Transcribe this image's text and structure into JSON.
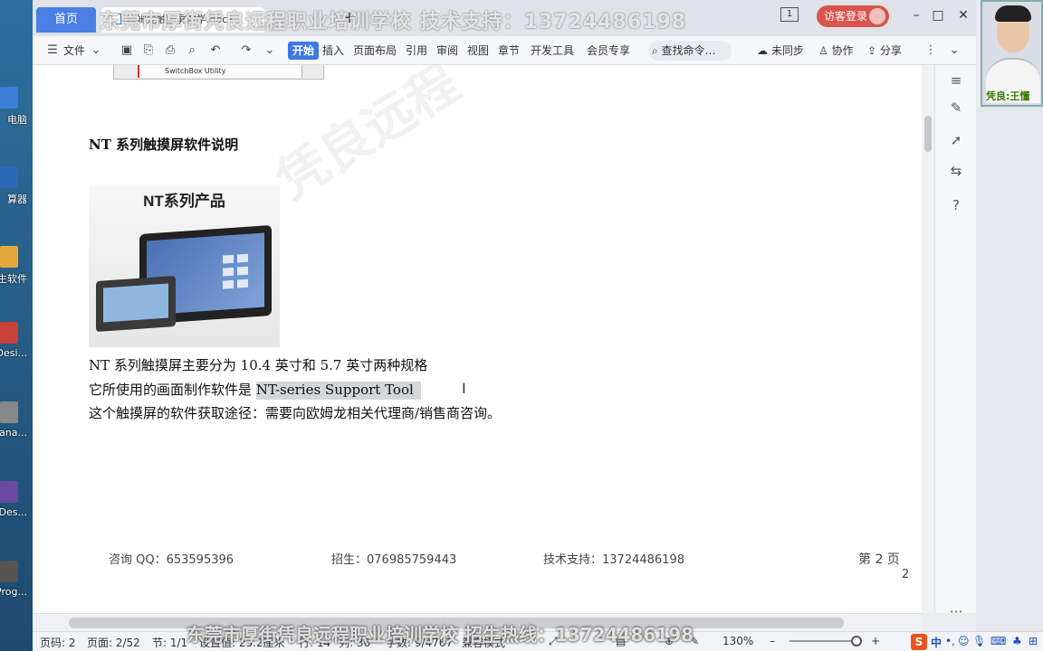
{
  "desktop": {
    "icons": [
      {
        "label": "电脑",
        "color": "#3a7fd5"
      },
      {
        "label": "算器",
        "color": "#2b68b8"
      },
      {
        "label": "生软件",
        "color": "#e0a93a"
      },
      {
        "label": "Desi...",
        "color": "#c8423a"
      },
      {
        "label": "Mana...",
        "color": "#888888"
      },
      {
        "label": "Des...",
        "color": "#6a4aa0"
      },
      {
        "label": "Prog...",
        "color": "#555555"
      }
    ]
  },
  "tabs": {
    "home": "首页",
    "document": "欧姆龙触摸屏教学.docx",
    "add": "+"
  },
  "banner_top": "东莞市厚街凭良远程职业培训学校  技术支持：13724486198",
  "window": {
    "counter": "1",
    "visitor_login": "访客登录",
    "minimize": "–",
    "maximize": "□",
    "close": "✕"
  },
  "toolbar": {
    "file_menu": "文件",
    "tabs": [
      "开始",
      "插入",
      "页面布局",
      "引用",
      "审阅",
      "视图",
      "章节",
      "开发工具",
      "会员专享"
    ],
    "search": "查找命令…",
    "sync": "未同步",
    "collab": "协作",
    "share": "分享"
  },
  "document": {
    "image_caption": "SwitchBox Utility",
    "heading": "NT 系列触摸屏软件说明",
    "product_title": "NT系列产品",
    "line1": "NT 系列触摸屏主要分为 10.4 英寸和 5.7 英寸两种规格",
    "line2_prefix": "它所使用的画面制作软件是 ",
    "line2_highlight": "NT-series Support Tool",
    "line3": "这个触摸屏的软件获取途径：需要向欧姆龙相关代理商/销售商咨询。",
    "footer_qq": "咨询 QQ：653595396",
    "footer_enroll": "招生：076985759443",
    "footer_support": "技术支持：13724486198",
    "footer_page": "第 2 页",
    "footer_page_num": "2",
    "watermark": "凭良远程"
  },
  "webcam": {
    "name": "凭良:王懂"
  },
  "statusbar": {
    "page_code": "页码: 2",
    "page": "页面: 2/52",
    "section": "节: 1/1",
    "position": "设置值: 23.2厘米",
    "row": "行: 14",
    "col": "列: 36",
    "words": "字数: 9/4767",
    "compat": "兼容模式",
    "zoom": "130%"
  },
  "banner_bottom": "东莞市厚街凭良远程职业培训学校  招生热线：13724486198",
  "ime": {
    "logo": "S",
    "mode": "中"
  }
}
